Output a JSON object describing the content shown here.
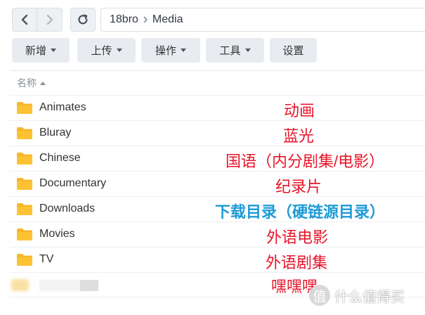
{
  "nav": {
    "breadcrumb": [
      "18bro",
      "Media"
    ]
  },
  "toolbar": {
    "buttons": [
      {
        "label": "新增",
        "has_menu": true
      },
      {
        "label": "上传",
        "has_menu": true
      },
      {
        "label": "操作",
        "has_menu": true
      },
      {
        "label": "工具",
        "has_menu": true
      },
      {
        "label": "设置",
        "has_menu": false
      }
    ]
  },
  "list": {
    "column_name": "名称",
    "sort": "ascending",
    "rows": [
      {
        "name": "Animates",
        "note": "动画"
      },
      {
        "name": "Bluray",
        "note": "蓝光"
      },
      {
        "name": "Chinese",
        "note": "国语（内分剧集/电影）"
      },
      {
        "name": "Documentary",
        "note": "纪录片"
      },
      {
        "name": "Downloads",
        "note": "下载目录（硬链源目录）"
      },
      {
        "name": "Movies",
        "note": "外语电影"
      },
      {
        "name": "TV",
        "note": "外语剧集"
      },
      {
        "name": "",
        "note": "嘿嘿嘿"
      }
    ]
  },
  "watermark": {
    "glyph": "值",
    "text": "什么值得买"
  },
  "colors": {
    "folder": "#f7b62a",
    "annotation": "#e8142a",
    "annotation_highlight": "#1e9ad6",
    "button_bg": "#e8ecf0"
  }
}
